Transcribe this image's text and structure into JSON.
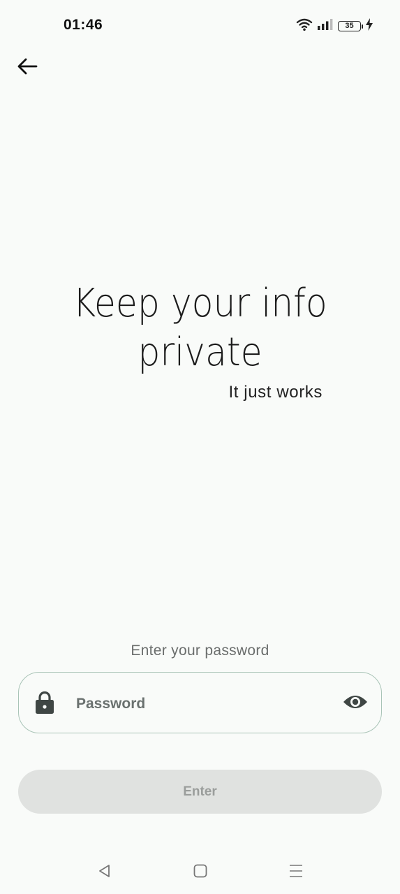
{
  "status_bar": {
    "time": "01:46",
    "battery_level": "35",
    "icons": [
      "wifi-icon",
      "signal-icon",
      "battery-icon",
      "charging-icon"
    ]
  },
  "header": {
    "back_icon": "arrow-left-icon"
  },
  "hero": {
    "title_line1": "Keep your info",
    "title_line2": "private",
    "subtitle": "It just works"
  },
  "form": {
    "prompt": "Enter your password",
    "password_placeholder": "Password",
    "password_value": "",
    "lock_icon": "lock-icon",
    "visibility_icon": "eye-icon",
    "enter_label": "Enter"
  },
  "navigation": {
    "buttons": [
      "back-triangle-icon",
      "home-square-icon",
      "menu-lines-icon"
    ]
  },
  "colors": {
    "background": "#f9fbf9",
    "field_border": "#a9c4b7",
    "button_disabled_bg": "#e0e2e0",
    "button_disabled_text": "#9a9d9b",
    "icon_dark": "#3f4644"
  }
}
